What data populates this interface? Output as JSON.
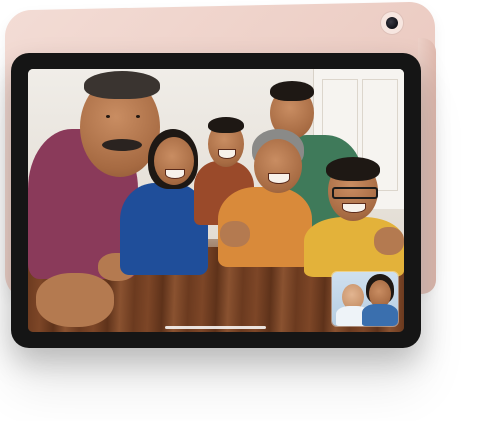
{
  "scene": {
    "description_hidden": "",
    "colors": {
      "ipad_back": "#eccdc4",
      "ipad_bezel": "#151515",
      "table_wood": "#6b3a1f"
    }
  },
  "call": {
    "participants_main": 6,
    "pip_participants": 2
  }
}
